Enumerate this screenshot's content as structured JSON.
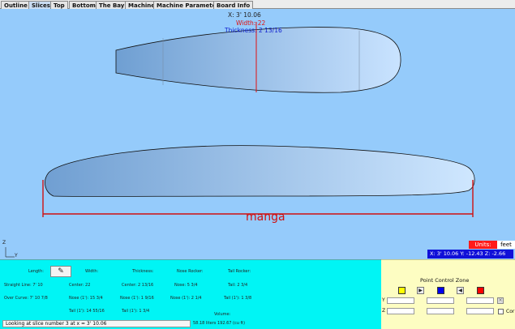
{
  "tabs": [
    "Outline",
    "Slices",
    "Top",
    "Bottom",
    "The Bay",
    "Machine",
    "Machine Parameters",
    "Board Info"
  ],
  "active_tab": "Slices",
  "slice_readout": {
    "x": "X: 3' 10.06",
    "width": "Width: 22",
    "thickness": "Thickness: 2 13/16"
  },
  "board_name": "manga",
  "axes": {
    "z": "Z",
    "y": "Y"
  },
  "units": {
    "label": "Units:",
    "value": "feet"
  },
  "coordinates": "X: 3' 10.06   Y: -12.43   Z: -2.66",
  "info": {
    "length_label": "Length:",
    "length_icon": "pencil-edit-icon",
    "width_label": "Width:",
    "thickness_label": "Thickness:",
    "nose_rocker_label": "Nose Rocker:",
    "tail_rocker_label": "Tail Rocker:",
    "straight_line": "Straight Line:   7'    10",
    "over_curve": "Over Curve:    7'     10 7/8",
    "center_width": "Center:   22",
    "nose_width": "Nose (1'):  15 3/4",
    "tail_width": "Tail (1'):   14 55/16",
    "center_thickness": "Center:  2 13/16",
    "nose_thickness": "Nose (1'):  1 9/16",
    "tail_thickness": "Tail (1'):  1 3/4",
    "nose_rocker": "Nose:    5 3/4",
    "nose_rocker_1ft": "Nose (1'):   2 1/4",
    "tail_rocker": "Tail:    2 3/4",
    "tail_rocker_1ft": "Tail (1'):   1 3/8",
    "volume_label": "Volume:",
    "volume_value": "58.18   liters   192.67   (cu ft)",
    "status": "Looking at slice number 3 at x = 3' 10.06"
  },
  "point_control": {
    "title": "Point Control Zone",
    "buttons": [
      {
        "name": "yellow-point-button",
        "color": "#ffff00"
      },
      {
        "name": "next-point-button",
        "glyph": "▶"
      },
      {
        "name": "blue-point-button",
        "color": "#0000ee"
      },
      {
        "name": "prev-point-button",
        "glyph": "◀"
      },
      {
        "name": "red-point-button",
        "color": "#ff0000"
      }
    ],
    "y_label": "Y",
    "z_label": "Z",
    "continuous_label": "Cor"
  },
  "colors": {
    "canvas_bg": "#95cbfb",
    "board_dark": "#6fa2d6",
    "board_light": "#cfe6ff",
    "slice_line": "#e01010",
    "info_bg": "#00f5f5",
    "pcz_bg": "#fdfdc2"
  }
}
